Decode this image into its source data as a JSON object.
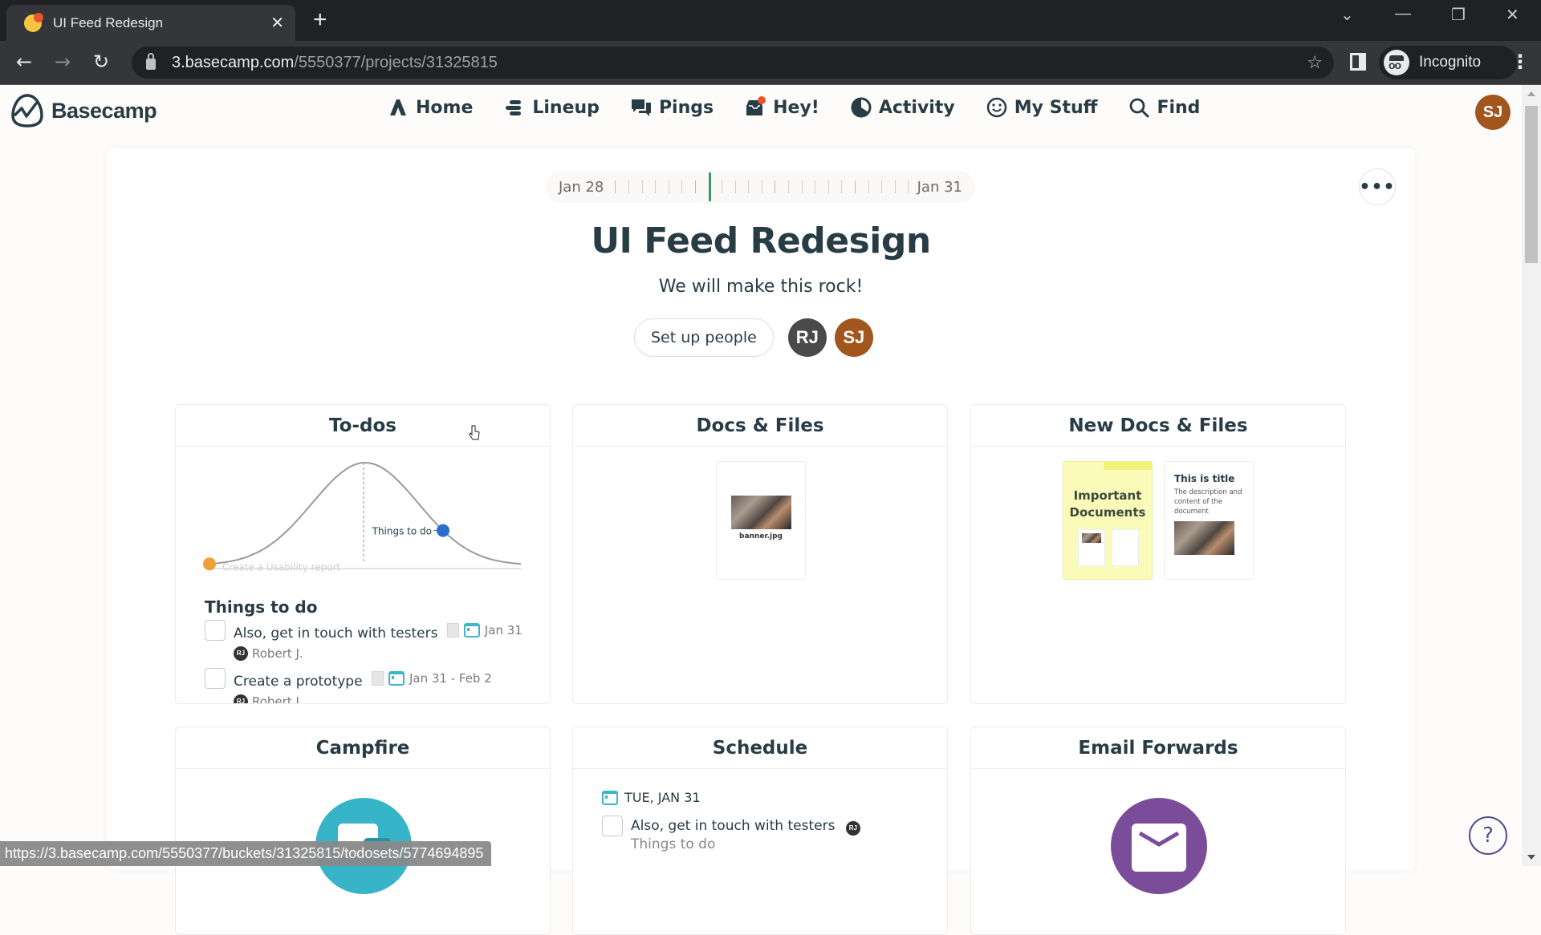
{
  "browser": {
    "tab_title": "UI Feed Redesign",
    "url_host": "3.basecamp.com",
    "url_path": "/5550377/projects/31325815",
    "profile_label": "Incognito",
    "status_url": "https://3.basecamp.com/5550377/buckets/31325815/todosets/5774694895"
  },
  "app": {
    "logo_text": "Basecamp",
    "nav": [
      {
        "label": "Home",
        "icon": "home-icon"
      },
      {
        "label": "Lineup",
        "icon": "lineup-icon"
      },
      {
        "label": "Pings",
        "icon": "pings-icon"
      },
      {
        "label": "Hey!",
        "icon": "hey-inbox-icon"
      },
      {
        "label": "Activity",
        "icon": "activity-icon"
      },
      {
        "label": "My Stuff",
        "icon": "smiley-icon"
      },
      {
        "label": "Find",
        "icon": "search-icon"
      }
    ],
    "user_initials": "SJ",
    "notification_color": "#e9552a"
  },
  "project": {
    "timeline_start": "Jan 28",
    "timeline_end": "Jan 31",
    "title": "UI Feed Redesign",
    "description": "We will make this rock!",
    "setup_people_label": "Set up people",
    "people": [
      {
        "initials": "RJ",
        "color": "#4a4a4a"
      },
      {
        "initials": "SJ",
        "color": "#a0561c"
      }
    ]
  },
  "tools": {
    "todos": {
      "title": "To-dos",
      "hill": {
        "points": [
          {
            "label": "Create a Usability report",
            "color": "#f0a03a",
            "position": 0.0
          },
          {
            "label": "Things to do",
            "color": "#2a6fc9",
            "position": 0.75
          }
        ]
      },
      "list_title": "Things to do",
      "items": [
        {
          "text": "Also, get in touch with testers",
          "date": "Jan 31",
          "assignee_initials": "RJ",
          "assignee": "Robert J."
        },
        {
          "text": "Create a prototype",
          "date": "Jan 31 - Feb 2",
          "assignee_initials": "RJ",
          "assignee": "Robert J."
        }
      ]
    },
    "docs": {
      "title": "Docs & Files",
      "files": [
        {
          "name": "banner.jpg"
        }
      ]
    },
    "new_docs": {
      "title": "New Docs & Files",
      "folder_title": "Important Documents",
      "doc_title": "This is title",
      "doc_description": "The description and content of the document"
    },
    "campfire": {
      "title": "Campfire",
      "color": "#37b4c8"
    },
    "schedule": {
      "title": "Schedule",
      "date": "TUE, JAN 31",
      "item": "Also, get in touch with testers",
      "item_initials": "RJ",
      "item_list": "Things to do"
    },
    "email": {
      "title": "Email Forwards",
      "color": "#7b4c9a"
    }
  },
  "help_label": "?"
}
